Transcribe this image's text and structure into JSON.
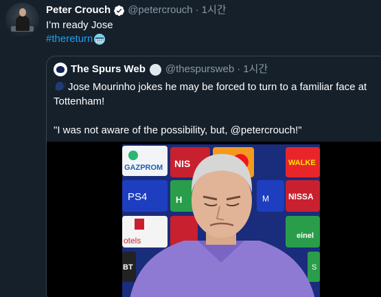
{
  "tweet": {
    "author_name": "Peter Crouch",
    "author_handle": "@petercrouch",
    "separator": "·",
    "time": "1시간",
    "text": "I’m ready Jose",
    "hashtag": "#thereturn",
    "emoji": "weary-face-emoji"
  },
  "quote": {
    "author_name": "The Spurs Web",
    "author_handle": "@thespursweb",
    "separator": "·",
    "time": "1시간",
    "line1": "Jose Mourinho jokes he may be forced to turn to a familiar face at Tottenham!",
    "line2": "\"I was not aware of the possibility, but, @petercrouch!\"",
    "speaker_icon": "speaking-head-emoji"
  },
  "media": {
    "sponsor_labels": [
      "GAZPROM",
      "NIS",
      "WALKE",
      "PS4",
      "NISSA",
      "H",
      "M",
      "otels",
      "einel",
      "BT",
      "S"
    ]
  },
  "colors": {
    "background": "#15202b",
    "secondary_text": "#8899a6",
    "link": "#1da1f2",
    "border": "#38444d"
  }
}
